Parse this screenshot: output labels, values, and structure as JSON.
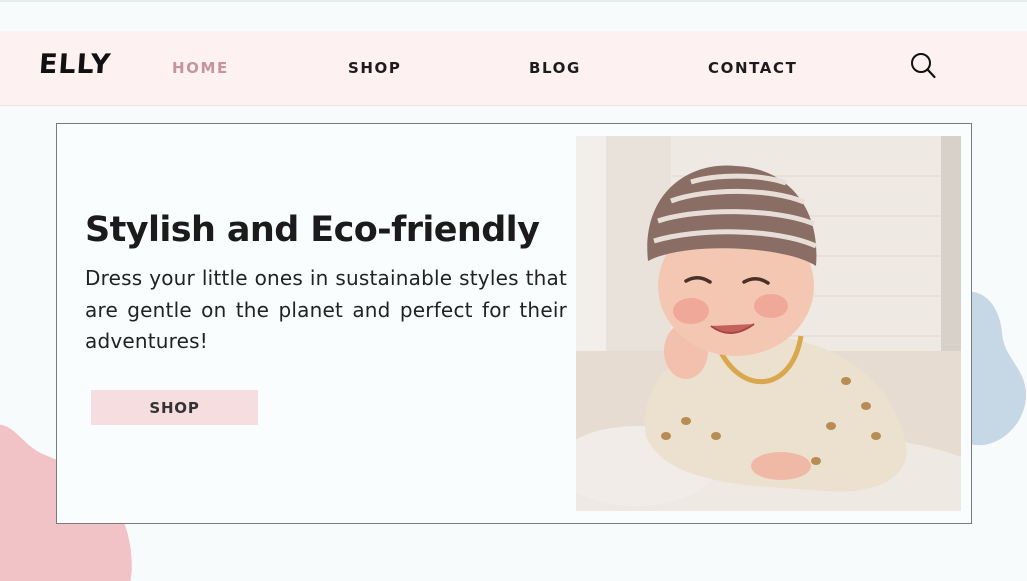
{
  "brand": {
    "logo": "ELLY"
  },
  "nav": {
    "items": [
      {
        "label": "HOME",
        "active": true
      },
      {
        "label": "SHOP",
        "active": false
      },
      {
        "label": "BLOG",
        "active": false
      },
      {
        "label": "CONTACT",
        "active": false
      }
    ],
    "search_icon": "search-icon"
  },
  "hero": {
    "title": "Stylish and Eco-friendly",
    "text": "Dress your little ones in sustainable styles that are gentle on the planet and perfect for their adventures!",
    "button_label": "SHOP",
    "image": "baby-in-striped-beanie-photo"
  },
  "colors": {
    "nav_background": "#fdf1f1",
    "active_nav": "#c4949f",
    "button_background": "#f6dde0",
    "blob_pink": "#f1c3c6",
    "blob_blue": "#c6d7e6"
  }
}
